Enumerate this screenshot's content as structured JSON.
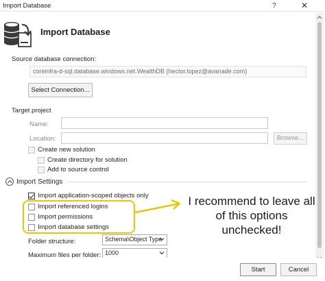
{
  "window": {
    "title": "Import Database",
    "help_glyph": "?",
    "close_glyph": "✕"
  },
  "header": {
    "title": "Import Database"
  },
  "source": {
    "label": "Source database connection:",
    "connection_string": "coreinfra-d-sql.database.windows.net.WealthDB (hector.lopez@avanade.com)",
    "select_button": "Select Connection..."
  },
  "target": {
    "label": "Target project",
    "name_label": "Name:",
    "name_value": "",
    "location_label": "Location:",
    "location_value": "",
    "browse_button": "Browse...",
    "create_new_solution": "Create new solution",
    "create_directory": "Create directory for solution",
    "add_to_source_control": "Add to source control"
  },
  "import_settings": {
    "label": "Import Settings",
    "options": [
      {
        "label": "Import application-scoped objects only",
        "checked": true
      },
      {
        "label": "Import referenced logins",
        "checked": false
      },
      {
        "label": "Import permissions",
        "checked": false
      },
      {
        "label": "Import database settings",
        "checked": false
      }
    ],
    "folder_structure_label": "Folder structure:",
    "folder_structure_value": "Schema\\Object Type",
    "max_files_label": "Maximum files per folder:",
    "max_files_value": "1000"
  },
  "annotation": {
    "text": "I recommend to leave all of this options unchecked!",
    "color": "#f0c300"
  },
  "footer": {
    "start_button": "Start",
    "cancel_button": "Cancel"
  }
}
